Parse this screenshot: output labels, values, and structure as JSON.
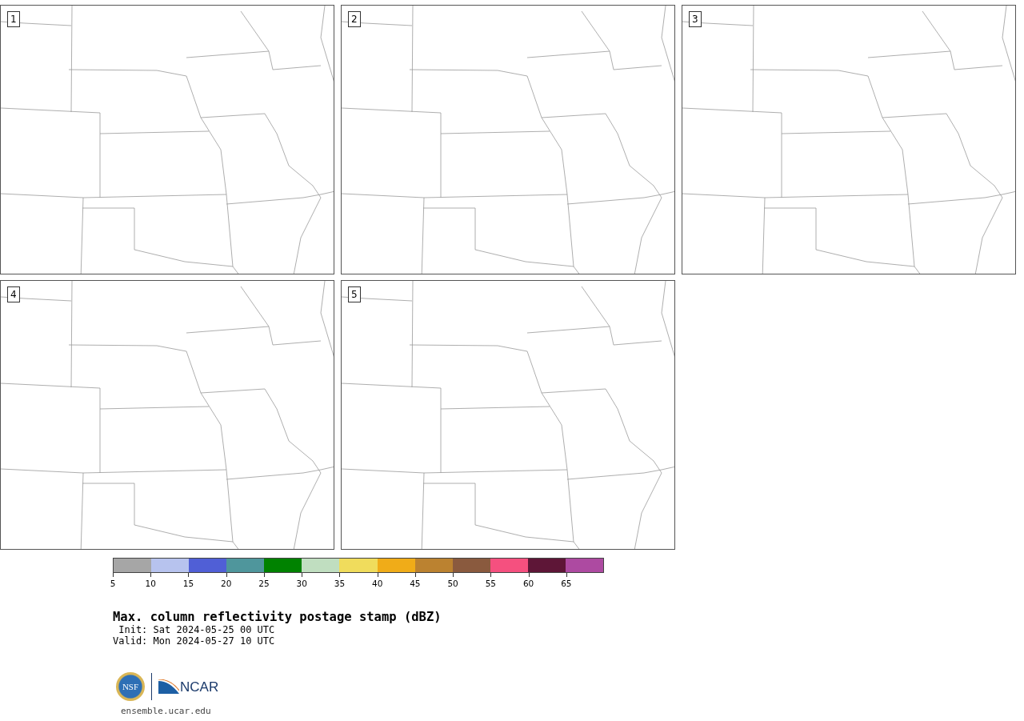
{
  "panels": [
    {
      "number": "1"
    },
    {
      "number": "2"
    },
    {
      "number": "3"
    },
    {
      "number": "4"
    },
    {
      "number": "5"
    }
  ],
  "colorbar": {
    "bins": [
      {
        "label": "5",
        "color": "#a6a6a6"
      },
      {
        "label": "10",
        "color": "#b7c3ee"
      },
      {
        "label": "15",
        "color": "#505fd6"
      },
      {
        "label": "20",
        "color": "#4f969c"
      },
      {
        "label": "25",
        "color": "#008200"
      },
      {
        "label": "30",
        "color": "#c0dec0"
      },
      {
        "label": "35",
        "color": "#f0dc5c"
      },
      {
        "label": "40",
        "color": "#f0ac18"
      },
      {
        "label": "45",
        "color": "#bb8230"
      },
      {
        "label": "50",
        "color": "#8a5a3e"
      },
      {
        "label": "55",
        "color": "#f5507f"
      },
      {
        "label": "60",
        "color": "#5e1637"
      },
      {
        "label": "65",
        "color": "#ad4aa1"
      }
    ]
  },
  "title": "Max. column reflectivity postage stamp (dBZ)",
  "init": " Init: Sat 2024-05-25 00 UTC",
  "valid": "Valid: Mon 2024-05-27 10 UTC",
  "logo": {
    "left": "NSF",
    "right": "NCAR"
  },
  "url": "ensemble.ucar.edu"
}
